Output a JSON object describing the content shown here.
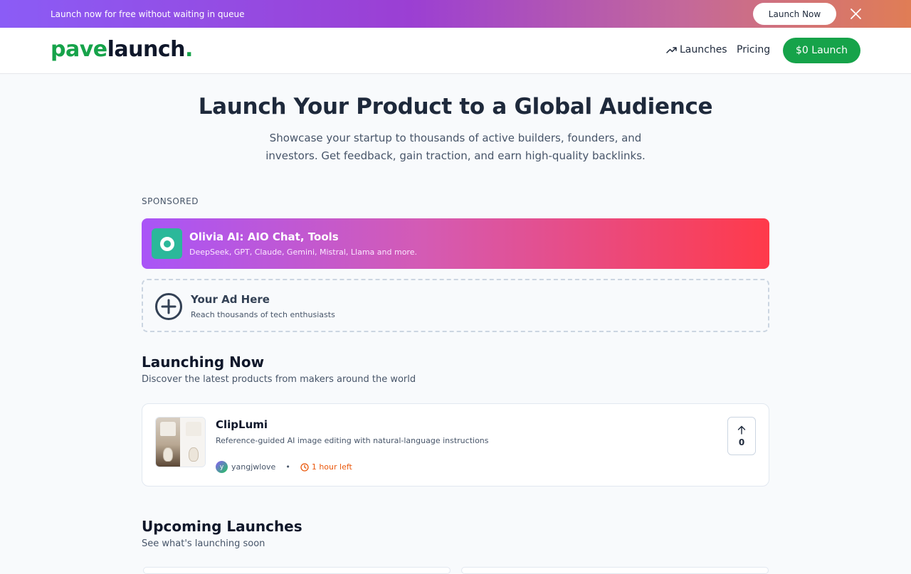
{
  "promo": {
    "text": "Launch now for free without waiting in queue",
    "button_label": "Launch Now",
    "close_icon": "close-icon"
  },
  "header": {
    "logo_part1": "pave",
    "logo_part2": "launch",
    "logo_dot": ".",
    "nav": {
      "launches_label": "Launches",
      "launches_icon": "trending-up-icon",
      "pricing_label": "Pricing",
      "cta_label": "$0 Launch"
    }
  },
  "hero": {
    "title": "Launch Your Product to a Global Audience",
    "subtitle": "Showcase your startup to thousands of active builders, founders, and investors. Get feedback, gain traction, and earn high-quality backlinks."
  },
  "sponsored": {
    "label": "SPONSORED",
    "card": {
      "title": "Olivia AI: AIO Chat, Tools",
      "description": "DeepSeek, GPT, Claude, Gemini, Mistral, Llama and more."
    },
    "ad_slot": {
      "title": "Your Ad Here",
      "description": "Reach thousands of tech enthusiasts",
      "icon": "plus-circle-icon"
    }
  },
  "launching_now": {
    "title": "Launching Now",
    "subtitle": "Discover the latest products from makers around the world",
    "products": [
      {
        "name": "ClipLumi",
        "description": "Reference-guided AI image editing with natural-language instructions",
        "author": "yangjwlove",
        "avatar_letter": "y",
        "separator": "•",
        "time_left": "1 hour left",
        "upvotes": "0"
      }
    ]
  },
  "upcoming": {
    "title": "Upcoming Launches",
    "subtitle": "See what's launching soon"
  },
  "colors": {
    "brand_green": "#16a34a",
    "time_orange": "#ea580c"
  }
}
